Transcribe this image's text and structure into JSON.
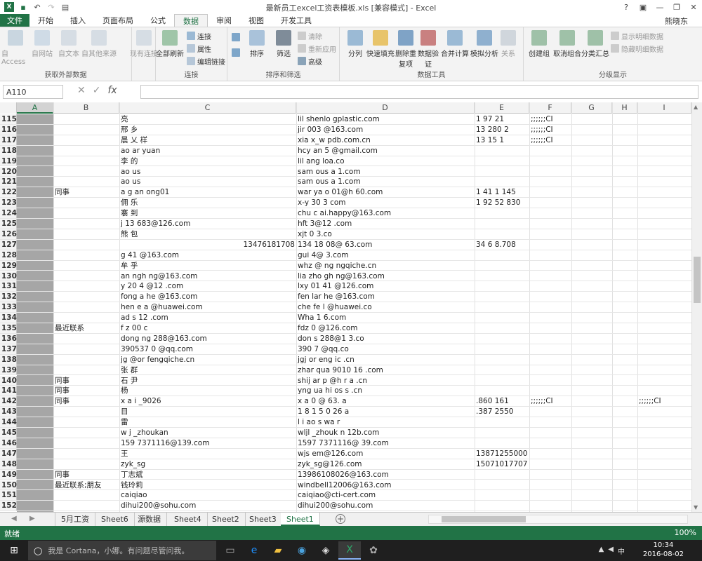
{
  "title_bar": {
    "title": "最新员工excel工资表模板.xls  [兼容模式] - Excel",
    "qat_icons": [
      "excel-logo-icon",
      "save-icon",
      "undo-icon",
      "redo-icon",
      "customize-icon"
    ],
    "help": "?",
    "minimize": "—",
    "restore": "❐",
    "close": "✕"
  },
  "tabs": [
    "文件",
    "开始",
    "插入",
    "页面布局",
    "公式",
    "数据",
    "审阅",
    "视图",
    "开发工具"
  ],
  "active_tab": "数据",
  "user_name": "熊晓东",
  "ribbon": {
    "group_external": {
      "label": "获取外部数据",
      "buttons": [
        "自 Access",
        "自网站",
        "自文本",
        "自其他来源",
        "现有连接"
      ]
    },
    "group_connections": {
      "label": "连接",
      "refresh": "全部刷新",
      "small": [
        "连接",
        "属性",
        "编辑链接"
      ]
    },
    "group_sort": {
      "label": "排序和筛选",
      "sort": "排序",
      "filter": "筛选",
      "small": [
        "清除",
        "重新应用",
        "高级"
      ]
    },
    "group_tools": {
      "label": "数据工具",
      "buttons": [
        "分列",
        "快速填充",
        "删除重复项",
        "数据验证",
        "合并计算",
        "模拟分析",
        "关系"
      ]
    },
    "group_outline": {
      "label": "分级显示",
      "buttons": [
        "创建组",
        "取消组合",
        "分类汇总"
      ],
      "small": [
        "显示明细数据",
        "隐藏明细数据"
      ]
    }
  },
  "formula_bar": {
    "name_box": "A110",
    "formula": ""
  },
  "columns": [
    "A",
    "B",
    "C",
    "D",
    "E",
    "F",
    "G",
    "H",
    "I"
  ],
  "rows": [
    {
      "n": "115",
      "b": "",
      "c": "   亮",
      "d": "lil shenlo gplastic.com",
      "e": "1 97  21",
      "f": ";;;;;;CI",
      "i": ""
    },
    {
      "n": "116",
      "b": "",
      "c": "  邢 乡",
      "d": "jir 003  @163.com",
      "e": "13  280 2",
      "f": ";;;;;;CI",
      "i": ""
    },
    {
      "n": "117",
      "b": "",
      "c": " 晨 乂 样",
      "d": "xia x_w  pdb.com.cn",
      "e": "13  15 1",
      "f": ";;;;;;CI",
      "i": ""
    },
    {
      "n": "118",
      "b": "",
      "c": "  ao ar  yuan",
      "d": "hcy an 5 @gmail.com",
      "e": "",
      "f": "",
      "i": ""
    },
    {
      "n": "119",
      "b": "",
      "c": " 李 的",
      "d": "lil ang  loa.co",
      "e": "",
      "f": "",
      "i": ""
    },
    {
      "n": "120",
      "b": "",
      "c": " ao us",
      "d": "sam ous  a 1.com",
      "e": "",
      "f": "",
      "i": ""
    },
    {
      "n": "121",
      "b": "",
      "c": " ao us",
      "d": "sam ous  a 1.com",
      "e": "",
      "f": "",
      "i": ""
    },
    {
      "n": "122",
      "b": "同事",
      "c": " a g an ong01",
      "d": "war ya  o 01@h 60.com",
      "e": "1 41  1 145",
      "f": "",
      "i": ""
    },
    {
      "n": "123",
      "b": "",
      "c": " 佣 乐 ",
      "d": "x-y 30  3 com",
      "e": "1 92 52 830",
      "f": "",
      "i": ""
    },
    {
      "n": "124",
      "b": "",
      "c": " 褰 到 ",
      "d": "chu c  ai.happy@163.com",
      "e": "",
      "f": "",
      "i": ""
    },
    {
      "n": "125",
      "b": "",
      "c": " j 13 683@126.com",
      "d": "hft   3@12 .com",
      "e": "",
      "f": "",
      "i": ""
    },
    {
      "n": "126",
      "b": "",
      "c": " 熊 包 ",
      "d": "xjt  0  3.co",
      "e": "",
      "f": "",
      "i": ""
    },
    {
      "n": "127",
      "b": "",
      "c": "",
      "c2": "13476181708",
      "d": "134  18  08@ 63.com",
      "e": "34 6 8.708",
      "f": "",
      "i": ""
    },
    {
      "n": "128",
      "b": "",
      "c": " g 41 @163.com",
      "d": "gui  4@ 3.com",
      "e": "",
      "f": "",
      "i": ""
    },
    {
      "n": "129",
      "b": "",
      "c": " 牟 乎",
      "d": "whz  @ ng ngqiche.cn",
      "e": "",
      "f": "",
      "i": ""
    },
    {
      "n": "130",
      "b": "",
      "c": " an  ngh ng@163.com",
      "d": "lia zho gh ng@163.com",
      "e": "",
      "f": "",
      "i": ""
    },
    {
      "n": "131",
      "b": "",
      "c": " y 20  4 @12 .com",
      "d": "lxy 01  41 @126.com",
      "e": "",
      "f": "",
      "i": ""
    },
    {
      "n": "132",
      "b": "",
      "c": " fong a he @163.com",
      "d": "fen lar he @163.com",
      "e": "",
      "f": "",
      "i": ""
    },
    {
      "n": "133",
      "b": "",
      "c": " hen e a @huawei.com",
      "d": "che fe l @huawei.co",
      "e": "",
      "f": "",
      "i": ""
    },
    {
      "n": "134",
      "b": "",
      "c": "  ad s 12 .com",
      "d": "Wha   1 6.com",
      "e": "",
      "f": "",
      "i": ""
    },
    {
      "n": "135",
      "b": "最近联系",
      "c": " f z 00 c",
      "d": "fdz 0   @126.com",
      "e": "",
      "f": "",
      "i": ""
    },
    {
      "n": "136",
      "b": "",
      "c": " dong ng 288@163.com",
      "d": "don s  288@1 3.co",
      "e": "",
      "f": "",
      "i": ""
    },
    {
      "n": "137",
      "b": "",
      "c": " 390537 0 @qq.com",
      "d": "390  7 @qq.co",
      "e": "",
      "f": "",
      "i": ""
    },
    {
      "n": "138",
      "b": "",
      "c": " jg @or fengqiche.cn",
      "d": "jgj  or  eng ic .cn",
      "e": "",
      "f": "",
      "i": ""
    },
    {
      "n": "139",
      "b": "",
      "c": " 张 群",
      "d": "zhar  qua 9010 16 .com",
      "e": "",
      "f": "",
      "i": ""
    },
    {
      "n": "140",
      "b": "同事",
      "c": " 石 尹 ",
      "d": "shij ar p @h r  a .cn",
      "e": "",
      "f": "",
      "i": ""
    },
    {
      "n": "141",
      "b": "同事",
      "c": " 杨 ",
      "d": "yng ua  hi os  s .cn",
      "e": "",
      "f": "",
      "i": ""
    },
    {
      "n": "142",
      "b": "同事",
      "c": " x a i _9026",
      "d": "x a   0 @ 63. a",
      "e": ".860  161",
      "f": ";;;;;;CI",
      "i": ";;;;;;CI"
    },
    {
      "n": "143",
      "b": "",
      "c": " 目 ",
      "d": "1 8 1 5 0  26 a",
      "e": ".387 2550",
      "f": "",
      "i": ""
    },
    {
      "n": "144",
      "b": "",
      "c": " 雷 ",
      "d": "l i ao  s wa  r",
      "e": "",
      "f": "",
      "i": ""
    },
    {
      "n": "145",
      "b": "",
      "c": " w j _zhoukan",
      "d": "wljl _zhouk n 12b.com",
      "e": "",
      "f": "",
      "i": ""
    },
    {
      "n": "146",
      "b": "",
      "c": " 159 7371116@139.com",
      "d": "1597 7371116@ 39.com",
      "e": "",
      "f": "",
      "i": ""
    },
    {
      "n": "147",
      "b": "",
      "c": " 王 ",
      "d": "wjs em@126.com",
      "e": "13871255000",
      "f": "",
      "i": ""
    },
    {
      "n": "148",
      "b": "",
      "c": " zyk_sg",
      "d": "zyk_sg@126.com",
      "e": "15071017707",
      "f": "",
      "i": ""
    },
    {
      "n": "149",
      "b": "同事",
      "c": " 丁志斌",
      "d": "13986108026@163.com",
      "e": "",
      "f": "",
      "i": ""
    },
    {
      "n": "150",
      "b": "最近联系;朋友",
      "c": " 钱玲莉",
      "d": "windbell12006@163.com",
      "e": "",
      "f": "",
      "i": ""
    },
    {
      "n": "151",
      "b": "",
      "c": " caiqiao",
      "d": "caiqiao@cti-cert.com",
      "e": "",
      "f": "",
      "i": ""
    },
    {
      "n": "152",
      "b": "",
      "c": " dihui200@sohu.com",
      "d": "dihui200@sohu.com",
      "e": "",
      "f": "",
      "i": ""
    }
  ],
  "sheet_tabs": [
    "5月工资",
    "Sheet6",
    "源数据",
    "Sheet4",
    "Sheet2",
    "Sheet3",
    "Sheet1"
  ],
  "active_sheet": "Sheet1",
  "status": {
    "ready": "就绪",
    "zoom": "100%"
  },
  "taskbar": {
    "search_placeholder": "我是 Cortana，小娜。有问题尽管问我。",
    "time": "10:34",
    "date": "2016-08-02"
  }
}
